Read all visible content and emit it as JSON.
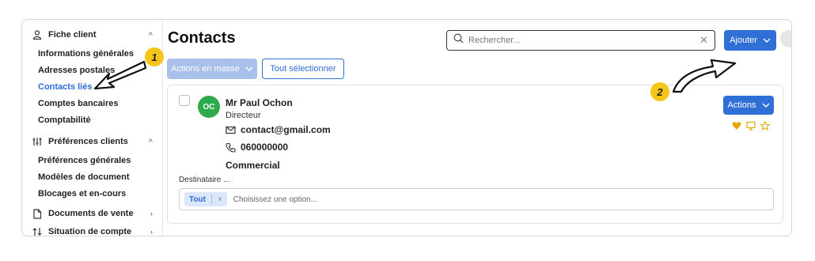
{
  "sidebar": {
    "groups": [
      {
        "label": "Fiche client",
        "icon": "user-icon"
      },
      {
        "label": "Préférences clients",
        "icon": "sliders-icon"
      },
      {
        "label": "Documents de vente",
        "icon": "document-icon"
      },
      {
        "label": "Situation de compte",
        "icon": "sort-icon"
      }
    ],
    "fiche_items": [
      "Informations générales",
      "Adresses postales",
      "Contacts liés",
      "Comptes bancaires",
      "Comptabilité"
    ],
    "pref_items": [
      "Préférences générales",
      "Modèles de document",
      "Blocages et en-cours"
    ],
    "active_item": "Contacts liés"
  },
  "main": {
    "title": "Contacts",
    "search_placeholder": "Rechercher...",
    "add_label": "Ajouter",
    "mass_actions_label": "Actions en masse",
    "select_all_label": "Tout sélectionner"
  },
  "contact": {
    "initials": "OC",
    "name": "Mr Paul Ochon",
    "role": "Directeur",
    "email": "contact@gmail.com",
    "phone": "060000000",
    "department": "Commercial",
    "recipient_label": "Destinataire ...",
    "recipient_tag": "Tout",
    "recipient_tag_remove": "×",
    "recipient_placeholder": "Choisissez une option...",
    "actions_label": "Actions"
  },
  "annotations": [
    {
      "number": "1"
    },
    {
      "number": "2"
    }
  ],
  "colors": {
    "primary": "#2f6fd6",
    "primary_disabled": "#a9c0ea",
    "avatar": "#2eaa4e",
    "badge": "#f5c518",
    "icon_accent": "#e3a800"
  }
}
